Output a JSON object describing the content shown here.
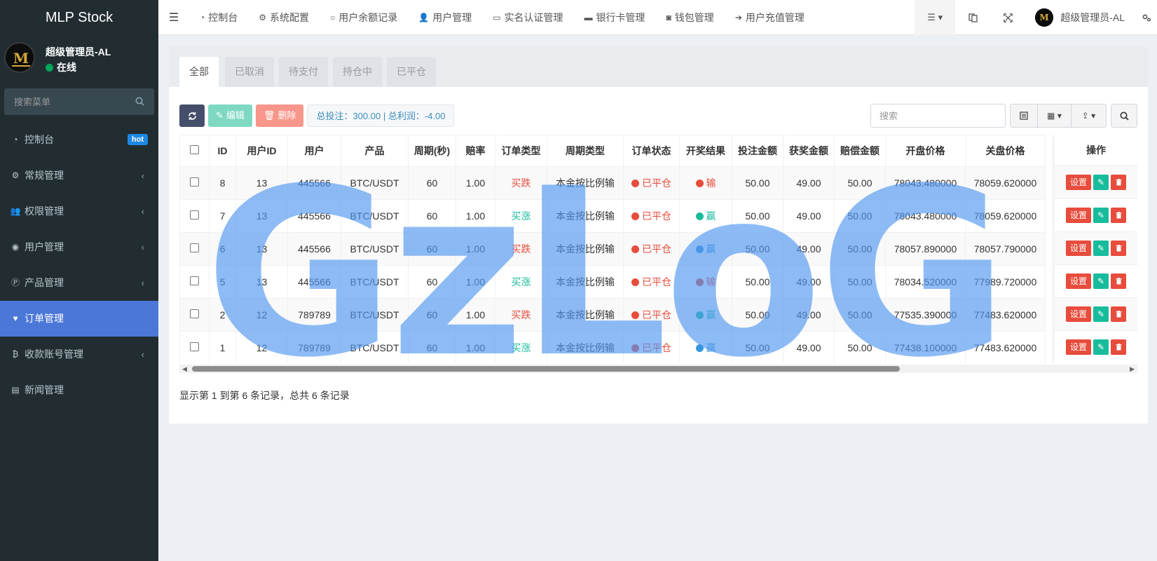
{
  "app": {
    "title": "MLP Stock"
  },
  "user": {
    "name": "超级管理员-AL",
    "status": "在线"
  },
  "sidebar": {
    "search_placeholder": "搜索菜单",
    "items": [
      {
        "label": "控制台",
        "icon": "dashboard-icon",
        "badge": "hot",
        "has_children": false,
        "active": false
      },
      {
        "label": "常规管理",
        "icon": "cogs-icon",
        "has_children": true,
        "active": false
      },
      {
        "label": "权限管理",
        "icon": "group-icon",
        "has_children": true,
        "active": false
      },
      {
        "label": "用户管理",
        "icon": "user-circle-icon",
        "has_children": true,
        "active": false
      },
      {
        "label": "产品管理",
        "icon": "product-icon",
        "has_children": true,
        "active": false
      },
      {
        "label": "订单管理",
        "icon": "heartbeat-icon",
        "has_children": false,
        "active": true
      },
      {
        "label": "收款账号管理",
        "icon": "bitcoin-icon",
        "has_children": true,
        "active": false
      },
      {
        "label": "新闻管理",
        "icon": "newspaper-icon",
        "has_children": false,
        "active": false
      }
    ]
  },
  "topnav": {
    "items": [
      {
        "label": "控制台",
        "icon": "dashboard-icon"
      },
      {
        "label": "系统配置",
        "icon": "gear-icon"
      },
      {
        "label": "用户余额记录",
        "icon": "circle-icon"
      },
      {
        "label": "用户管理",
        "icon": "user-icon"
      },
      {
        "label": "实名认证管理",
        "icon": "id-card-icon"
      },
      {
        "label": "银行卡管理",
        "icon": "credit-card-icon"
      },
      {
        "label": "钱包管理",
        "icon": "wallet-icon"
      },
      {
        "label": "用户充值管理",
        "icon": "sign-in-icon"
      }
    ],
    "user_name": "超级管理员-AL"
  },
  "tabs": [
    {
      "label": "全部",
      "active": true
    },
    {
      "label": "已取消",
      "active": false
    },
    {
      "label": "待支付",
      "active": false
    },
    {
      "label": "持仓中",
      "active": false
    },
    {
      "label": "已平仓",
      "active": false
    }
  ],
  "toolbar": {
    "edit_label": "编辑",
    "delete_label": "删除",
    "summary": "总投注：300.00 | 总利润：-4.00",
    "search_placeholder": "搜索"
  },
  "table": {
    "columns": [
      "ID",
      "用户ID",
      "用户",
      "产品",
      "周期(秒)",
      "赔率",
      "订单类型",
      "周期类型",
      "订单状态",
      "开奖结果",
      "投注金额",
      "获奖金额",
      "赔偿金额",
      "开盘价格",
      "关盘价格"
    ],
    "ops_header": "操作",
    "ops_set_label": "设置",
    "rows": [
      {
        "id": "8",
        "uid": "13",
        "user": "445566",
        "product": "BTC/USDT",
        "period": "60",
        "odds": "1.00",
        "type": "买跌",
        "dir": "down",
        "cycle": "本金按比例输",
        "status": "已平仓",
        "result": "输",
        "result_color": "#e74c3c",
        "bet": "50.00",
        "win": "49.00",
        "comp": "50.00",
        "open": "78043.480000",
        "close": "78059.620000"
      },
      {
        "id": "7",
        "uid": "13",
        "user": "445566",
        "product": "BTC/USDT",
        "period": "60",
        "odds": "1.00",
        "type": "买涨",
        "dir": "up",
        "cycle": "本金按比例输",
        "status": "已平仓",
        "result": "赢",
        "result_color": "#18bc9c",
        "bet": "50.00",
        "win": "49.00",
        "comp": "50.00",
        "open": "78043.480000",
        "close": "78059.620000"
      },
      {
        "id": "6",
        "uid": "13",
        "user": "445566",
        "product": "BTC/USDT",
        "period": "60",
        "odds": "1.00",
        "type": "买跌",
        "dir": "down",
        "cycle": "本金按比例输",
        "status": "已平仓",
        "result": "赢",
        "result_color": "#3498db",
        "bet": "50.00",
        "win": "49.00",
        "comp": "50.00",
        "open": "78057.890000",
        "close": "78057.790000"
      },
      {
        "id": "5",
        "uid": "13",
        "user": "445566",
        "product": "BTC/USDT",
        "period": "60",
        "odds": "1.00",
        "type": "买涨",
        "dir": "up",
        "cycle": "本金按比例输",
        "status": "已平仓",
        "result": "输",
        "result_color": "#e74c3c",
        "bet": "50.00",
        "win": "49.00",
        "comp": "50.00",
        "open": "78034.520000",
        "close": "77989.720000"
      },
      {
        "id": "2",
        "uid": "12",
        "user": "789789",
        "product": "BTC/USDT",
        "period": "60",
        "odds": "1.00",
        "type": "买跌",
        "dir": "down",
        "cycle": "本金按比例输",
        "status": "已平仓",
        "result": "赢",
        "result_color": "#18bc9c",
        "bet": "50.00",
        "win": "49.00",
        "comp": "50.00",
        "open": "77535.390000",
        "close": "77483.620000"
      },
      {
        "id": "1",
        "uid": "12",
        "user": "789789",
        "product": "BTC/USDT",
        "period": "60",
        "odds": "1.00",
        "type": "买涨",
        "dir": "up",
        "cycle": "本金按比例输",
        "status": "已平仓",
        "result": "赢",
        "result_color": "#3498db",
        "bet": "50.00",
        "win": "49.00",
        "comp": "50.00",
        "open": "77438.100000",
        "close": "77483.620000"
      }
    ]
  },
  "pagination": {
    "text": "显示第 1 到第 6 条记录，总共 6 条记录"
  },
  "watermark": "GzLoG",
  "colors": {
    "sidebar_bg": "#222d32",
    "active_menu": "#4b77d8",
    "danger": "#e74c3c",
    "success": "#18bc9c",
    "info": "#3498db"
  }
}
